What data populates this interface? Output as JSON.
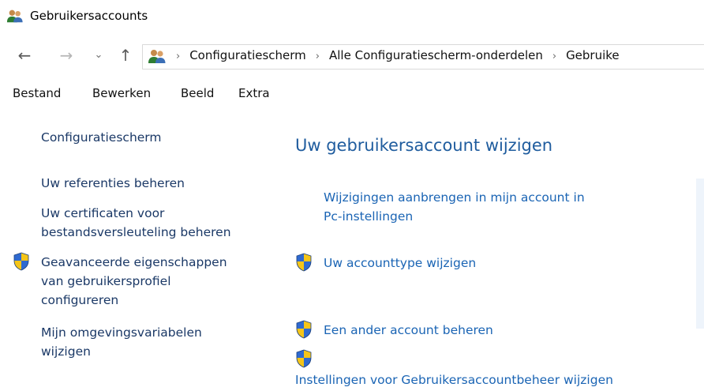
{
  "window": {
    "title": "Gebruikersaccounts"
  },
  "address": {
    "crumbs": [
      "Configuratiescherm",
      "Alle Configuratiescherm-onderdelen",
      "Gebruike"
    ]
  },
  "menu": [
    "Bestand",
    "Bewerken",
    "Beeld",
    "Extra"
  ],
  "sidebar": {
    "home": "Configuratiescherm",
    "items": [
      {
        "label_line1": "Uw referenties beheren"
      },
      {
        "label_line1": "Uw certificaten voor",
        "label_line2": "bestandsversleuteling beheren"
      },
      {
        "label_line1": "Geavanceerde eigenschappen",
        "label_line2": "van gebruikersprofiel",
        "label_line3": "configureren",
        "icon": "uac-shield-icon"
      },
      {
        "label_line1": "Mijn omgevingsvariabelen",
        "label_line2": "wijzigen"
      }
    ]
  },
  "main": {
    "title": "Uw gebruikersaccount wijzigen",
    "tasks": [
      {
        "line1": "Wijzigingen aanbrengen in mijn account in",
        "line2": "Pc-instellingen"
      },
      {
        "label": "Uw accounttype wijzigen",
        "icon": "uac-shield-icon"
      },
      {
        "label": "Een ander account beheren",
        "icon": "uac-shield-icon"
      },
      {
        "label": "Instellingen voor Gebruikersaccountbeheer wijzigen",
        "icon": "uac-shield-icon"
      }
    ]
  },
  "colors": {
    "link": "#1a64b4",
    "heading": "#1f5c9e",
    "sidebar_link": "#1a3866",
    "shield_blue": "#2f6ad0",
    "shield_yellow": "#f5c518"
  }
}
